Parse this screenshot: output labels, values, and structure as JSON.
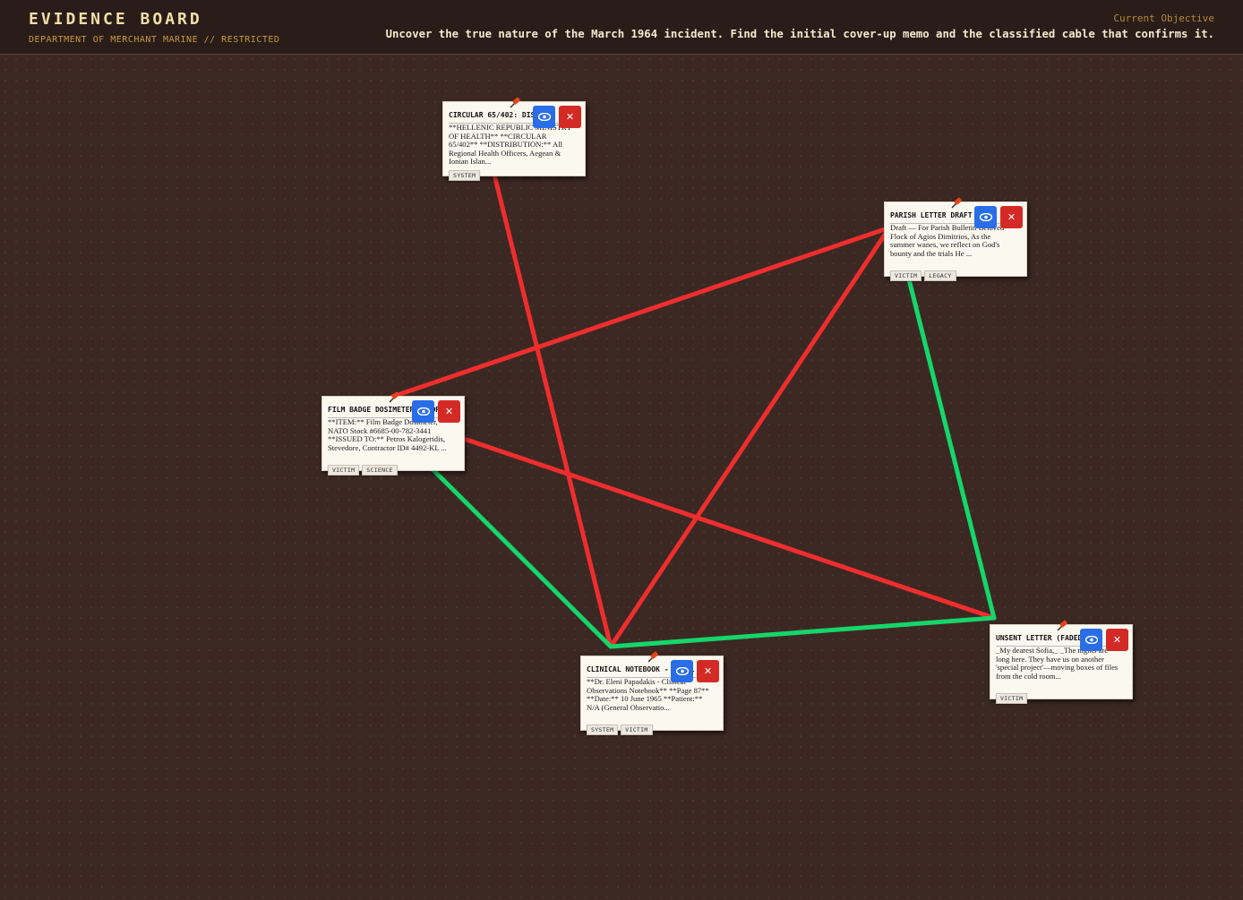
{
  "header": {
    "title": "EVIDENCE BOARD",
    "subtitle": "DEPARTMENT OF MERCHANT MARINE // RESTRICTED",
    "objective_label": "Current Objective",
    "objective_text": "Uncover the true nature of the March 1964 incident. Find the initial cover-up memo and the classified cable that confirms it."
  },
  "colors": {
    "string_red": "#ee2e2e",
    "string_green": "#15d66a",
    "view_button": "#2a6de8",
    "close_button": "#d42a26"
  },
  "cards": [
    {
      "id": "circular",
      "title": "CIRCULAR 65/402: DIST",
      "body": "**HELLENIC REPUBLIC MINISTRY OF HEALTH** **CIRCULAR 65/402** **DISTRIBUTION:** All Regional Health Officers, Aegean & Ionian Islan...",
      "tags": [
        "SYSTEM"
      ],
      "view_icon": "eye-icon",
      "close_icon": "close-icon"
    },
    {
      "id": "parish",
      "title": "PARISH LETTER DRAFT",
      "body": "Draft — For Parish Bulletin Beloved Flock of Agios Dimitrios, As the summer wanes, we reflect on God's bounty and the trials He ...",
      "tags": [
        "VICTIM",
        "LEGACY"
      ],
      "view_icon": "eye-icon",
      "close_icon": "close-icon"
    },
    {
      "id": "filmbadge",
      "title": "FILM BADGE DOSIMETER RECORD",
      "body": "**ITEM:** Film Badge Dosimeter, NATO Stock #6685-00-782-3441 **ISSUED TO:** Petros Kalogeridis, Stevedore, Contractor ID# 4492-KL ...",
      "tags": [
        "VICTIM",
        "SCIENCE"
      ],
      "view_icon": "eye-icon",
      "close_icon": "close-icon"
    },
    {
      "id": "clinical",
      "title": "CLINICAL NOTEBOOK - DR. L",
      "body": "**Dr. Eleni Papadakis - Clinical Observations Notebook** **Page 87** **Date:** 10 June 1965 **Patient:** N/A (General Observatio...",
      "tags": [
        "SYSTEM",
        "VICTIM"
      ],
      "view_icon": "eye-icon",
      "close_icon": "close-icon"
    },
    {
      "id": "unsent",
      "title": "UNSENT LETTER (FADED)",
      "body": "_My dearest Sofia,_ _The nights are long here. They have us on another 'special project'—moving boxes of files from the cold room...",
      "tags": [
        "VICTIM"
      ],
      "view_icon": "eye-icon",
      "close_icon": "close-icon"
    }
  ],
  "connections": [
    {
      "from": "circular",
      "to": "clinical",
      "color": "red"
    },
    {
      "from": "parish",
      "to": "filmbadge",
      "color": "red"
    },
    {
      "from": "parish",
      "to": "clinical",
      "color": "red"
    },
    {
      "from": "filmbadge",
      "to": "unsent",
      "color": "red"
    },
    {
      "from": "filmbadge",
      "to": "clinical",
      "color": "green"
    },
    {
      "from": "clinical",
      "to": "unsent",
      "color": "green"
    },
    {
      "from": "parish",
      "to": "unsent",
      "color": "green"
    }
  ]
}
